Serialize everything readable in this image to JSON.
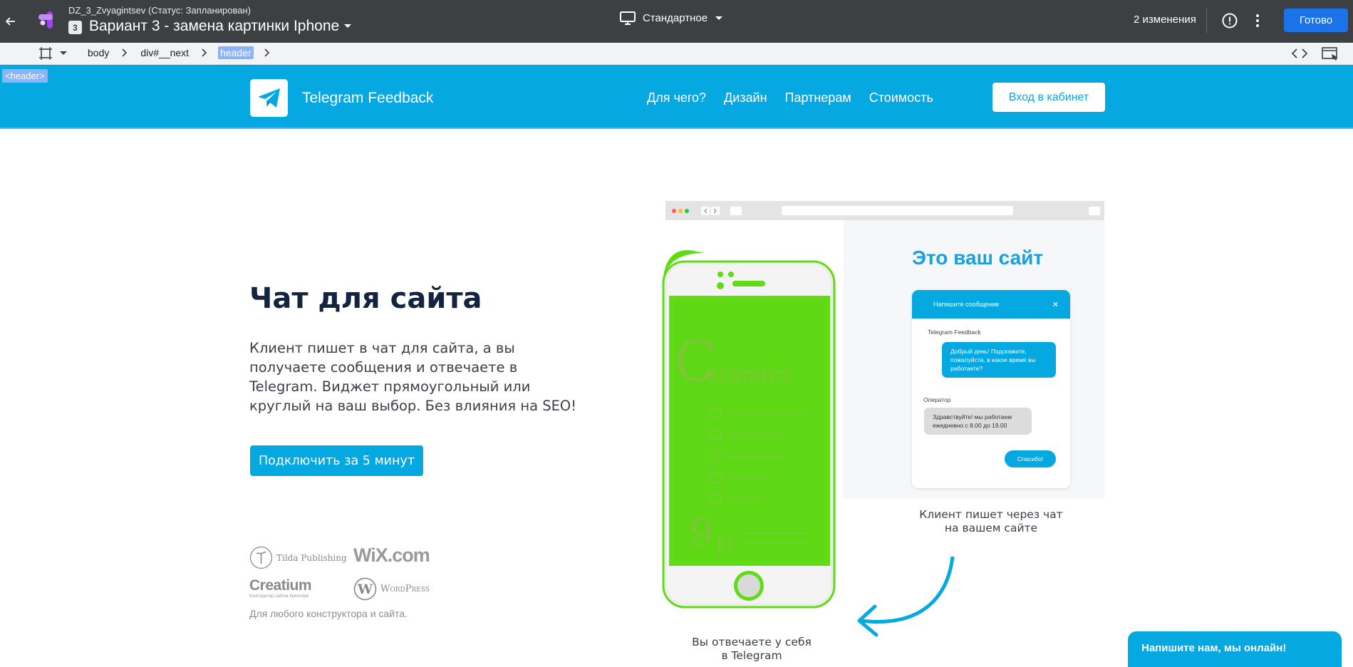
{
  "editor": {
    "project_subtitle": "DZ_3_Zvyagintsev (Статус: Запланирован)",
    "variant_number": "3",
    "variant_title": "Вариант 3 - замена картинки Iphone",
    "device_label": "Стандартное",
    "changes_label": "2 изменения",
    "done_label": "Готово"
  },
  "breadcrumbs": [
    "body",
    "div#__next",
    "header"
  ],
  "selection_tag": "<header>",
  "site": {
    "brand_name": "Telegram Feedback",
    "nav": [
      "Для чего?",
      "Дизайн",
      "Партнерам",
      "Стоимость"
    ],
    "login_label": "Вход в кабинет",
    "hero_title": "Чат для сайта",
    "hero_text": "Клиент пишет в чат для сайта, а вы получаете сообщения и отвечаете в Telegram. Виджет прямоугольный или круглый на ваш выбор. Без влияния на SEO!",
    "cta_label": "Подключить за 5 минут",
    "partners": {
      "tilda": "Tilda Publishing",
      "wix": "WiX.com",
      "creatium": "Creatium",
      "creatium_sub": "Конструктор сайтов Креатиум",
      "wordpress": "WordPress"
    },
    "partners_note": "Для любого конструктора и сайта.",
    "mockup": {
      "site_heading": "Это ваш сайт",
      "widget_title": "Напишите сообщение",
      "widget_close": "✕",
      "sender_label": "Telegram Feedback",
      "client_message": "Добрый день! Подскажите, пожалуйста, в какое время вы работаете?",
      "operator_label": "Оператор",
      "operator_message": "Здравствуйте! мы работаем ежедневно с 8.00 до 19.00",
      "thanks_button": "Спасибо!"
    },
    "caption_site": [
      "Клиент пишет через чат",
      "на вашем сайте"
    ],
    "caption_telegram": [
      "Вы отвечаете у себя",
      "в Telegram"
    ],
    "phone_screen": {
      "brand_big": "Ceramics",
      "brand_prefix": "C",
      "hardness": "9H"
    },
    "online_chip": "Напишите нам, мы онлайн!"
  },
  "colors": {
    "editor_bar": "#3c4043",
    "brand_blue": "#06a8e2",
    "done_button": "#1a73e8",
    "selection": "#8ab4f8",
    "hero_title": "#142340",
    "phone_green": "#5fdc16"
  },
  "icons": [
    "back-arrow-icon",
    "app-logo-icon",
    "desktop-icon",
    "chevron-down-icon",
    "alert-icon",
    "kebab-icon",
    "selector-icon",
    "chevron-right-icon",
    "code-icon",
    "preview-icon",
    "telegram-plane-icon",
    "arrow-curve-icon"
  ]
}
